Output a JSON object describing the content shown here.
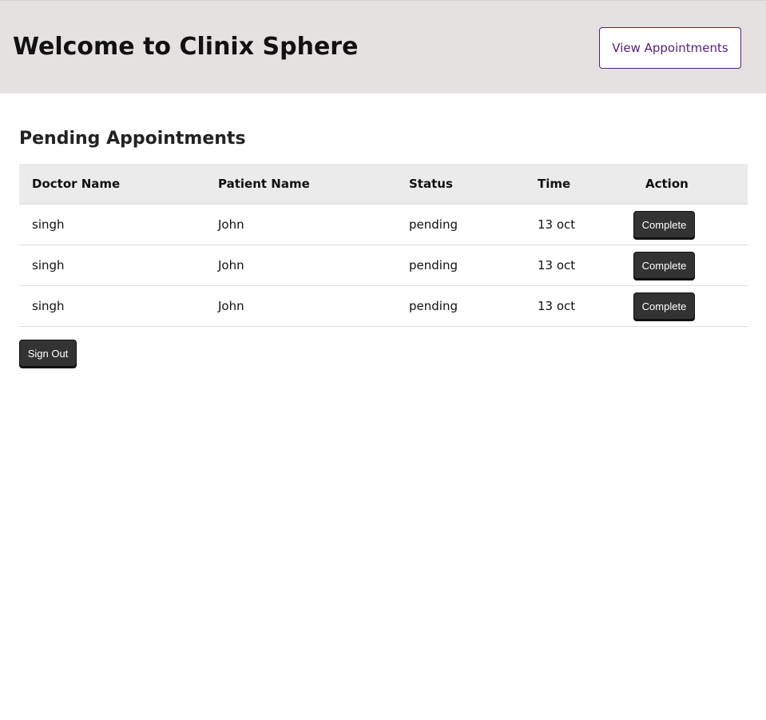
{
  "header": {
    "title": "Welcome to Clinix Sphere",
    "view_appointments_label": "View Appointments"
  },
  "main": {
    "section_title": "Pending Appointments",
    "table": {
      "columns": [
        "Doctor Name",
        "Patient Name",
        "Status",
        "Time",
        "Action"
      ],
      "rows": [
        {
          "doctor": "singh",
          "patient": "John",
          "status": "pending",
          "time": "13 oct",
          "action_label": "Complete"
        },
        {
          "doctor": "singh",
          "patient": "John",
          "status": "pending",
          "time": "13 oct",
          "action_label": "Complete"
        },
        {
          "doctor": "singh",
          "patient": "John",
          "status": "pending",
          "time": "13 oct",
          "action_label": "Complete"
        }
      ]
    },
    "sign_out_label": "Sign Out"
  },
  "colors": {
    "header_bg": "#e5e1e1",
    "accent": "#5a1d7a",
    "button_dark": "#333333",
    "table_header_bg": "#ebebeb"
  }
}
